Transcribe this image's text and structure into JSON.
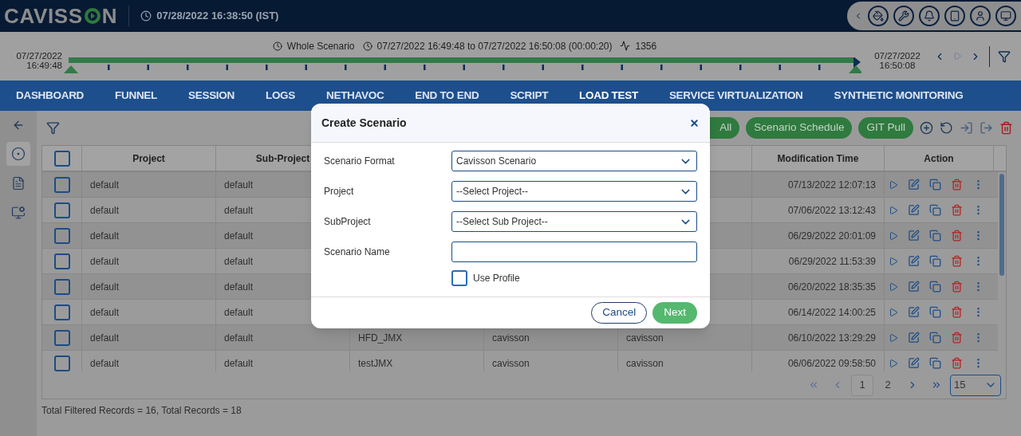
{
  "header": {
    "logo_start": "CAVISS",
    "logo_end": "N",
    "datetime": "07/28/2022 16:38:50 (IST)"
  },
  "timeline": {
    "scope": "Whole Scenario",
    "range_start": "07/27/2022 16:49:48",
    "range_to": "to",
    "range_end": "07/27/2022 16:50:08 (00:00:20)",
    "count": "1356",
    "start_date": "07/27/2022",
    "start_time": "16:49:48",
    "end_date": "07/27/2022",
    "end_time": "16:50:08",
    "level": 1
  },
  "nav": [
    {
      "label": "DASHBOARD",
      "selected": false
    },
    {
      "label": "FUNNEL",
      "selected": false
    },
    {
      "label": "SESSION",
      "selected": false
    },
    {
      "label": "LOGS",
      "selected": false
    },
    {
      "label": "NETHAVOC",
      "selected": false
    },
    {
      "label": "END TO END",
      "selected": false
    },
    {
      "label": "SCRIPT",
      "selected": false
    },
    {
      "label": "LOAD TEST",
      "selected": true
    },
    {
      "label": "SERVICE VIRTUALIZATION",
      "selected": false
    },
    {
      "label": "SYNTHETIC MONITORING",
      "selected": false
    }
  ],
  "sidebar": [
    {
      "kind": "scenario",
      "selected": true
    },
    {
      "kind": "list",
      "selected": false
    },
    {
      "kind": "ip",
      "selected": false
    }
  ],
  "toolbar": {
    "buttons": [
      "All",
      "Scenario Schedule",
      "GIT Pull"
    ]
  },
  "table": {
    "all_checked": false,
    "columns": [
      "Project",
      "Sub-Project",
      null,
      null,
      null,
      "Modification Time",
      "Action"
    ],
    "rows": [
      {
        "checked": false,
        "cells": [
          "default",
          "default",
          null,
          null,
          null,
          "07/13/2022 12:07:13"
        ]
      },
      {
        "checked": false,
        "cells": [
          "default",
          "default",
          null,
          null,
          null,
          "07/06/2022 13:12:43"
        ]
      },
      {
        "checked": false,
        "cells": [
          "default",
          "default",
          null,
          null,
          null,
          "06/29/2022 20:01:09"
        ]
      },
      {
        "checked": false,
        "cells": [
          "default",
          "default",
          null,
          null,
          null,
          "06/29/2022 11:53:39"
        ]
      },
      {
        "checked": false,
        "cells": [
          "default",
          "default",
          null,
          null,
          null,
          "06/20/2022 18:35:35"
        ]
      },
      {
        "checked": false,
        "cells": [
          "default",
          "default",
          null,
          null,
          null,
          "06/14/2022 14:00:25"
        ]
      },
      {
        "checked": false,
        "cells": [
          "default",
          "default",
          "HFD_JMX",
          "cavisson",
          "cavisson",
          "06/10/2022 13:29:29"
        ]
      },
      {
        "checked": false,
        "cells": [
          "default",
          "default",
          "testJMX",
          "cavisson",
          "cavisson",
          "06/06/2022 09:58:50"
        ]
      }
    ]
  },
  "pagination": {
    "pages": [
      {
        "label": "1",
        "selected": true
      },
      {
        "label": "2",
        "selected": false
      }
    ],
    "page_size": "15"
  },
  "footer": "Total Filtered Records = 16, Total Records = 18",
  "dialog": {
    "title": "Create Scenario",
    "fields": [
      {
        "label": "Scenario Format",
        "kind": "select",
        "value": "Cavisson Scenario"
      },
      {
        "label": "Project",
        "kind": "select",
        "value": "--Select Project--"
      },
      {
        "label": "SubProject",
        "kind": "select",
        "value": "--Select Sub Project--"
      },
      {
        "label": "Scenario Name",
        "kind": "text"
      }
    ],
    "use_profile": {
      "label": "Use Profile",
      "checked": false
    },
    "cancel": "Cancel",
    "next": "Next"
  }
}
